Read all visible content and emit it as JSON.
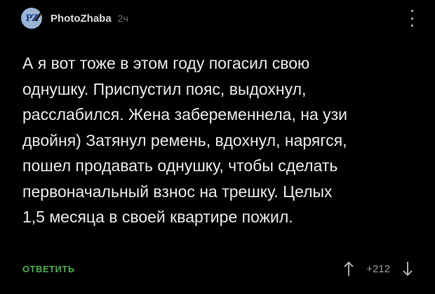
{
  "comment": {
    "author": "PhotoZhaba",
    "avatar_letters": "PZ",
    "time": "2ч",
    "icons": {
      "menu": "more-vertical-icon",
      "upvote": "arrow-up-icon",
      "downvote": "arrow-down-icon"
    },
    "lines": [
      "А я вот тоже в этом году погасил свою",
      "однушку. Приспустил пояс, выдохнул,",
      "расслабился. Жена забеременнела, на узи",
      "двойня) Затянул ремень, вдохнул, нарягся,",
      "пошел продавать однушку, чтобы сделать",
      "первоначальный взнос на трешку. Целых",
      "1,5 месяца в своей квартире пожил."
    ],
    "reply_label": "ОТВЕТИТЬ",
    "rating": "+212"
  },
  "colors": {
    "background": "#000000",
    "text": "#e8e8e8",
    "accent_green": "#4caf50",
    "muted": "#9a9a9a"
  }
}
